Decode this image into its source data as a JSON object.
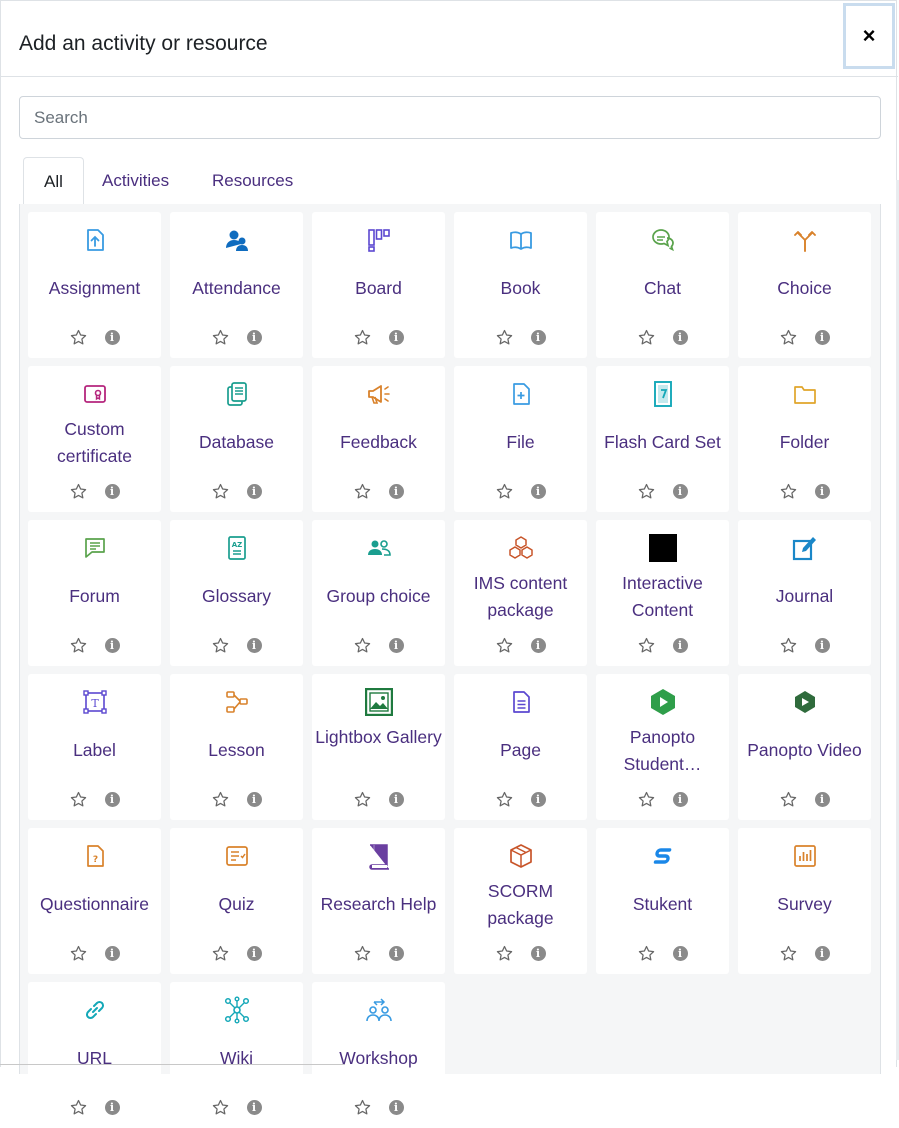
{
  "dialog": {
    "title": "Add an activity or resource",
    "close_symbol": "×"
  },
  "search": {
    "placeholder": "Search",
    "value": ""
  },
  "tabs": [
    {
      "label": "All",
      "active": true
    },
    {
      "label": "Activities",
      "active": false
    },
    {
      "label": "Resources",
      "active": false
    }
  ],
  "items": [
    {
      "name": "Assignment",
      "icon": "assignment-icon",
      "color": "#399be2"
    },
    {
      "name": "Attendance",
      "icon": "attendance-icon",
      "color": "#0f6cbf"
    },
    {
      "name": "Board",
      "icon": "board-icon",
      "color": "#5b48d0"
    },
    {
      "name": "Book",
      "icon": "book-icon",
      "color": "#399be2"
    },
    {
      "name": "Chat",
      "icon": "chat-icon",
      "color": "#5aa34c"
    },
    {
      "name": "Choice",
      "icon": "choice-icon",
      "color": "#d9822b"
    },
    {
      "name": "Custom certificate",
      "icon": "certificate-icon",
      "color": "#b5267d"
    },
    {
      "name": "Database",
      "icon": "database-icon",
      "color": "#1a9e8f"
    },
    {
      "name": "Feedback",
      "icon": "feedback-icon",
      "color": "#d9822b"
    },
    {
      "name": "File",
      "icon": "file-icon",
      "color": "#399be2"
    },
    {
      "name": "Flash Card Set",
      "icon": "flashcard-icon",
      "color": "#14a8b8"
    },
    {
      "name": "Folder",
      "icon": "folder-icon",
      "color": "#e0a52a"
    },
    {
      "name": "Forum",
      "icon": "forum-icon",
      "color": "#5aa34c"
    },
    {
      "name": "Glossary",
      "icon": "glossary-icon",
      "color": "#1a9e8f"
    },
    {
      "name": "Group choice",
      "icon": "group-choice-icon",
      "color": "#1a9e8f"
    },
    {
      "name": "IMS content package",
      "icon": "ims-package-icon",
      "color": "#c8552a"
    },
    {
      "name": "Interactive Content",
      "icon": "interactive-content-icon",
      "color": "#000000"
    },
    {
      "name": "Journal",
      "icon": "journal-icon",
      "color": "#1a87c8"
    },
    {
      "name": "Label",
      "icon": "label-icon",
      "color": "#5b48d0"
    },
    {
      "name": "Lesson",
      "icon": "lesson-icon",
      "color": "#d9822b"
    },
    {
      "name": "Lightbox Gallery",
      "icon": "gallery-icon",
      "color": "#1f7a3f"
    },
    {
      "name": "Page",
      "icon": "page-icon",
      "color": "#5b48d0"
    },
    {
      "name": "Panopto Student…",
      "icon": "panopto-icon",
      "color": "#2f9e4a"
    },
    {
      "name": "Panopto Video",
      "icon": "panopto-video-icon",
      "color": "#2f6b3c"
    },
    {
      "name": "Questionnaire",
      "icon": "questionnaire-icon",
      "color": "#d9822b"
    },
    {
      "name": "Quiz",
      "icon": "quiz-icon",
      "color": "#d9822b"
    },
    {
      "name": "Research Help",
      "icon": "research-book-icon",
      "color": "#6a3fa0"
    },
    {
      "name": "SCORM package",
      "icon": "scorm-icon",
      "color": "#c8552a"
    },
    {
      "name": "Stukent",
      "icon": "stukent-icon",
      "color": "#1a87e8"
    },
    {
      "name": "Survey",
      "icon": "survey-icon",
      "color": "#d9822b"
    },
    {
      "name": "URL",
      "icon": "link-icon",
      "color": "#14a8b8"
    },
    {
      "name": "Wiki",
      "icon": "wiki-icon",
      "color": "#14a8b8"
    },
    {
      "name": "Workshop",
      "icon": "workshop-icon",
      "color": "#399be2"
    }
  ],
  "info_glyph": "i"
}
